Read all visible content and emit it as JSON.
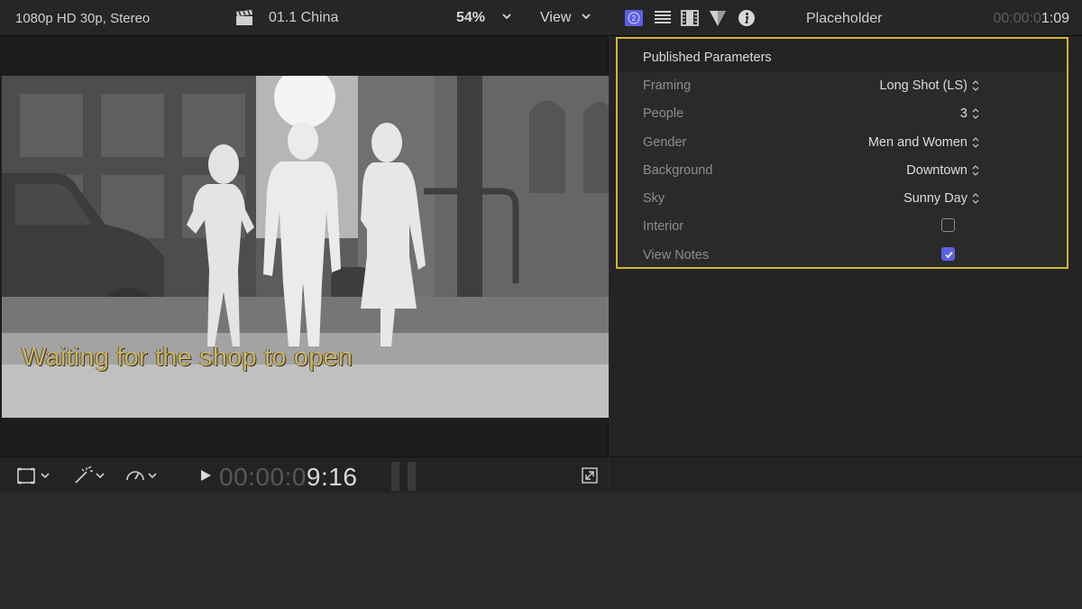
{
  "viewer": {
    "format": "1080p HD 30p, Stereo",
    "clip_name": "01.1 China",
    "zoom": "54%",
    "view_label": "View",
    "caption": "Waiting for the shop to open",
    "timecode_dim": "00:00:0",
    "timecode_bright": "9:16"
  },
  "inspector": {
    "title": "Placeholder",
    "timecode_dim": "00:00:0",
    "timecode_bright": "1:09",
    "section_title": "Published Parameters",
    "params": [
      {
        "label": "Framing",
        "value": "Long Shot (LS)"
      },
      {
        "label": "People",
        "value": "3"
      },
      {
        "label": "Gender",
        "value": "Men and Women"
      },
      {
        "label": "Background",
        "value": "Downtown"
      },
      {
        "label": "Sky",
        "value": "Sunny Day"
      }
    ],
    "checks": [
      {
        "label": "Interior",
        "checked": false
      },
      {
        "label": "View Notes",
        "checked": true
      }
    ]
  },
  "colors": {
    "accent": "#5b5fe6",
    "highlight_border": "#d2b531",
    "caption": "#c8b46a"
  },
  "icons": [
    "clapper-icon",
    "chevron-down-icon",
    "generator-inspector-icon",
    "text-inspector-icon",
    "film-inspector-icon",
    "filter-inspector-icon",
    "info-inspector-icon",
    "crop-transform-icon",
    "magic-wand-icon",
    "speedometer-icon",
    "play-icon",
    "fullscreen-icon",
    "stepper-icon",
    "checkmark-icon"
  ]
}
